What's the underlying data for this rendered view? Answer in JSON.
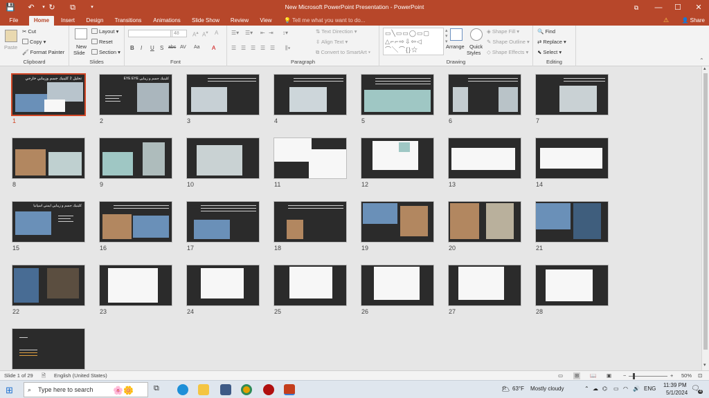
{
  "titlebar": {
    "title": "New Microsoft PowerPoint Presentation - PowerPoint",
    "quick_access": [
      {
        "name": "save-icon",
        "glyph": "💾"
      },
      {
        "name": "undo-icon",
        "glyph": "↶"
      },
      {
        "name": "redo-icon",
        "glyph": "↻"
      },
      {
        "name": "present-icon",
        "glyph": "⧉"
      },
      {
        "name": "customize-icon",
        "glyph": "▾"
      }
    ],
    "window_controls": {
      "restore": "⧉",
      "minimize": "—",
      "maximize": "☐",
      "close": "✕"
    }
  },
  "tabs": [
    "File",
    "Home",
    "Insert",
    "Design",
    "Transitions",
    "Animations",
    "Slide Show",
    "Review",
    "View"
  ],
  "active_tab": "Home",
  "tell_me": "Tell me what you want to do...",
  "share": "Share",
  "ribbon": {
    "clipboard": {
      "label": "Clipboard",
      "paste": "Paste",
      "cut": "Cut",
      "copy": "Copy",
      "format_painter": "Format Painter"
    },
    "slides": {
      "label": "Slides",
      "new_slide_1": "New",
      "new_slide_2": "Slide",
      "layout": "Layout",
      "reset": "Reset",
      "section": "Section"
    },
    "font": {
      "label": "Font",
      "font_name": "",
      "font_size": "48",
      "buttons": [
        "B",
        "I",
        "U",
        "S",
        "abc",
        "AV",
        "Aa",
        "A"
      ]
    },
    "paragraph": {
      "label": "Paragraph",
      "text_direction": "Text Direction",
      "align_text": "Align Text",
      "convert_smartart": "Convert to SmartArt"
    },
    "drawing": {
      "label": "Drawing",
      "arrange": "Arrange",
      "quick_styles_1": "Quick",
      "quick_styles_2": "Styles",
      "shape_fill": "Shape Fill",
      "shape_outline": "Shape Outline",
      "shape_effects": "Shape Effects"
    },
    "editing": {
      "label": "Editing",
      "find": "Find",
      "replace": "Replace",
      "select": "Select"
    }
  },
  "slides": [
    {
      "n": "1",
      "title": "تحليل 2 كلينيك جسم وزيبايي خارجي"
    },
    {
      "n": "2",
      "title": "كلينيك جسم و زيبايي EYE EYE"
    },
    {
      "n": "3"
    },
    {
      "n": "4"
    },
    {
      "n": "5"
    },
    {
      "n": "6"
    },
    {
      "n": "7"
    },
    {
      "n": "8"
    },
    {
      "n": "9"
    },
    {
      "n": "10"
    },
    {
      "n": "11"
    },
    {
      "n": "12"
    },
    {
      "n": "13"
    },
    {
      "n": "14"
    },
    {
      "n": "15",
      "title": "كلينيك جسم و زيبايي ايمني اسپانيا"
    },
    {
      "n": "16"
    },
    {
      "n": "17"
    },
    {
      "n": "18"
    },
    {
      "n": "19"
    },
    {
      "n": "20"
    },
    {
      "n": "21"
    },
    {
      "n": "22"
    },
    {
      "n": "23"
    },
    {
      "n": "24"
    },
    {
      "n": "25"
    },
    {
      "n": "26"
    },
    {
      "n": "27"
    },
    {
      "n": "28"
    },
    {
      "n": "29"
    }
  ],
  "selected_slide": "1",
  "status": {
    "slide_info": "Slide 1 of 29",
    "language": "English (United States)",
    "zoom": "50%"
  },
  "taskbar": {
    "search_placeholder": "Type here to search",
    "weather_temp": "63°F",
    "weather_text": "Mostly cloudy",
    "lang": "ENG",
    "time": "11:39 PM",
    "date": "5/1/2024",
    "notifications": "4"
  }
}
